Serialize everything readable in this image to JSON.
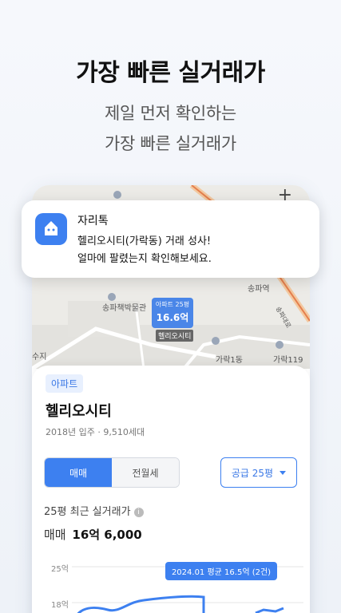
{
  "headline": "가장 빠른 실거래가",
  "subline1": "제일 먼저 확인하는",
  "subline2": "가장 빠른 실거래가",
  "map": {
    "zoom_label": "+",
    "labels": {
      "museum": "송파책박물관",
      "station": "송파역",
      "road": "송파대로",
      "garak1": "가락1동",
      "garak119": "가락119",
      "left_edge": "수지"
    },
    "pin": {
      "sub": "아파트 25평",
      "price": "16.6억",
      "name": "헬리오시티"
    }
  },
  "notification": {
    "app": "자리톡",
    "line1": "헬리오시티(가락동) 거래 성사!",
    "line2": "얼마에 팔렸는지 확인해보세요."
  },
  "card": {
    "badge": "아파트",
    "name": "헬리오시티",
    "meta": "2018년 입주 · 9,510세대",
    "tabs": {
      "sale": "매매",
      "rent": "전월세"
    },
    "area_select": "공급 25평",
    "section_title": "25평 최근 실거래가",
    "price_label": "매매",
    "price_value": "16억 6,000",
    "chart": {
      "tick_top": "25억",
      "tick_mid": "18억",
      "tooltip": "2024.01 평균 16.5억 (2건)"
    }
  },
  "colors": {
    "accent": "#3d80f0",
    "badge_bg": "#e8f0fe"
  }
}
